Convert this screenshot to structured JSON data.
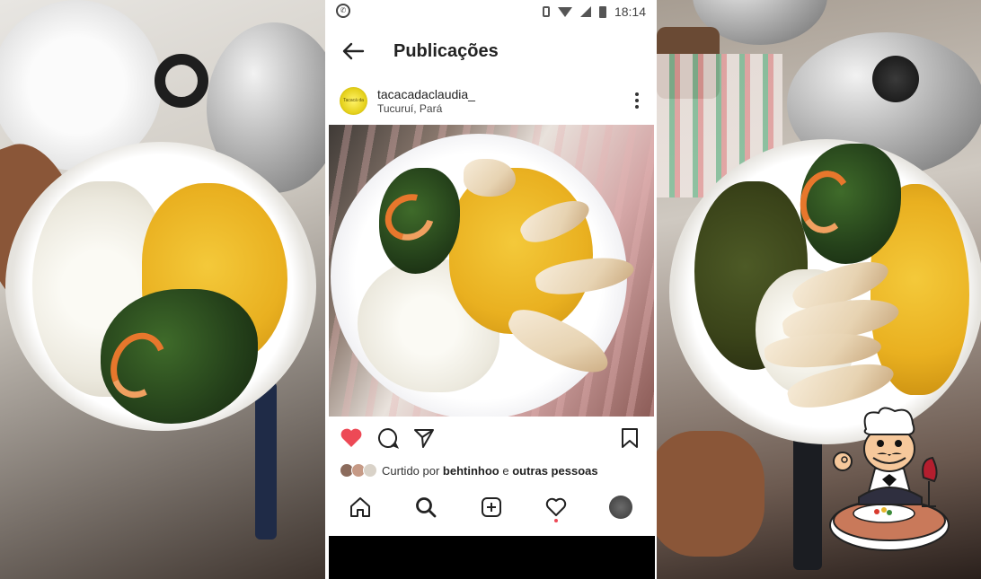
{
  "status_bar": {
    "time": "18:14",
    "icons": [
      "whatsapp-icon",
      "vibrate-icon",
      "wifi-icon",
      "signal-icon",
      "battery-icon"
    ]
  },
  "header": {
    "title": "Publicações",
    "back_icon": "arrow-left-icon"
  },
  "post": {
    "username": "tacacadaclaudia_",
    "location": "Tucuruí, Pará",
    "avatar_text": "Tacacá da Claudia",
    "liked": true,
    "liked_by_prefix": "Curtido por ",
    "liked_by_user": "behtinhoo",
    "liked_by_joiner": " e ",
    "liked_by_others": "outras pessoas"
  },
  "actions": [
    "heart-icon",
    "comment-icon",
    "share-icon",
    "bookmark-icon"
  ],
  "bottom_nav": [
    "home-icon",
    "search-icon",
    "new-post-icon",
    "activity-icon",
    "profile-avatar"
  ],
  "colors": {
    "like_red": "#ed4956",
    "text_dark": "#222222",
    "tacaca_yellow": "#eab320"
  }
}
